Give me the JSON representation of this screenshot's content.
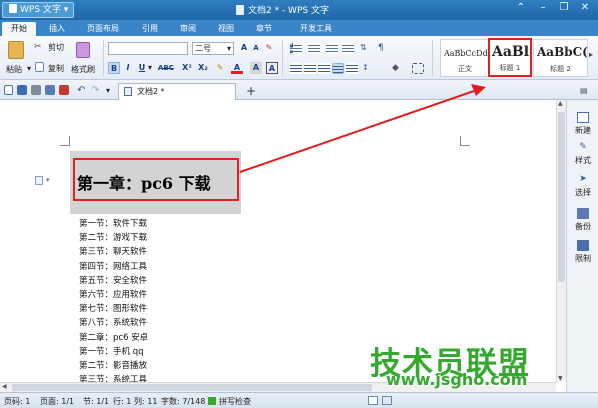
{
  "app": {
    "menu_button": "WPS 文字",
    "window_title": "文档2 * - WPS 文字"
  },
  "tabs": [
    "开始",
    "插入",
    "页面布局",
    "引用",
    "审阅",
    "视图",
    "章节",
    "开发工具"
  ],
  "ribbon": {
    "paste": "粘贴",
    "cut": "剪切",
    "copy": "复制",
    "format_painter": "格式刷",
    "font_size": "二号",
    "bold": "B",
    "italic": "I",
    "underline": "U",
    "strike": "ABC",
    "superscript": "X²",
    "subscript": "X₂",
    "font_color": "A",
    "styles": [
      {
        "sample": "AaBbCcDd",
        "name": "正文"
      },
      {
        "sample": "AaBl",
        "name": "标题 1"
      },
      {
        "sample": "AaBbC(A",
        "name": "标题 2"
      }
    ]
  },
  "document": {
    "tab_name": "文档2 *",
    "heading": "第一章：pc6 下载",
    "lines": [
      "第一节：软件下载",
      "第二节：游戏下载",
      "第三节：聊天软件",
      "第四节：网络工具",
      "第五节：安全软件",
      "第六节：应用软件",
      "第七节：图形软件",
      "第八节：系统软件",
      "第二章：pc6 安卓",
      "第一节：手机 qq",
      "第二节：影音播放",
      "第三节：系统工具"
    ]
  },
  "sidebar": [
    "新建",
    "样式",
    "选择",
    "备份",
    "限制"
  ],
  "status": {
    "page_no": "页码: 1",
    "pages": "页面: 1/1",
    "section": "节: 1/1",
    "row": "行: 1",
    "col": "列: 11",
    "words": "字数: 7/148",
    "spell": "拼写检查"
  },
  "watermark": {
    "text": "技术员联盟",
    "url": "www.jsgho.com"
  },
  "colors": {
    "title_bar": "#1f66a8",
    "annotation": "#e02020",
    "watermark": "#35a82f"
  }
}
